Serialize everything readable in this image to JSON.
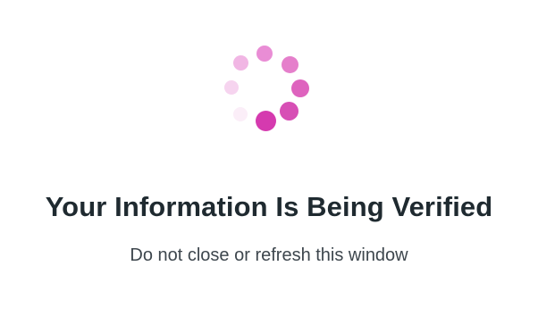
{
  "modal": {
    "spinner": {
      "icon": "loading-spinner-icon",
      "color": "#d63fb0"
    },
    "title": "Your Information Is Being Verified",
    "subtitle": "Do not close or refresh this window"
  }
}
